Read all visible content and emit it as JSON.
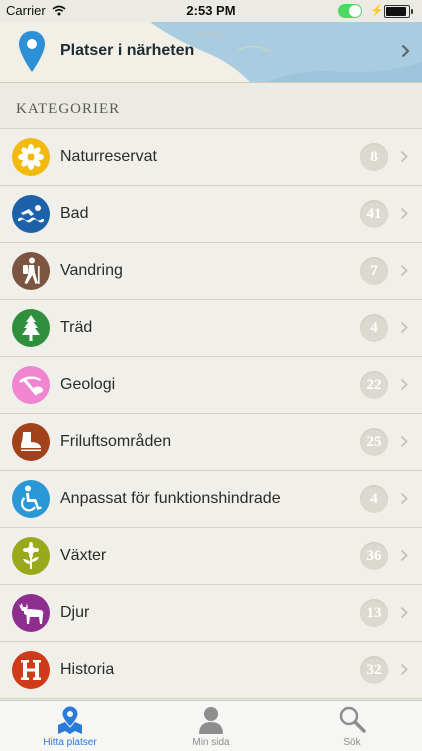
{
  "status_bar": {
    "carrier": "Carrier",
    "time": "2:53 PM"
  },
  "nearby": {
    "label": "Platser i närheten"
  },
  "section": {
    "title": "KATEGORIER"
  },
  "categories": [
    {
      "name": "Naturreservat",
      "count": "8",
      "icon": "flower-icon",
      "color": "#f2b90e"
    },
    {
      "name": "Bad",
      "count": "41",
      "icon": "swimmer-icon",
      "color": "#1d62a8"
    },
    {
      "name": "Vandring",
      "count": "7",
      "icon": "hiker-icon",
      "color": "#7b5542"
    },
    {
      "name": "Träd",
      "count": "4",
      "icon": "tree-icon",
      "color": "#2f8f3c"
    },
    {
      "name": "Geologi",
      "count": "22",
      "icon": "pickaxe-icon",
      "color": "#ef86cf"
    },
    {
      "name": "Friluftsområden",
      "count": "25",
      "icon": "boot-icon",
      "color": "#a2421c"
    },
    {
      "name": "Anpassat för funktionshindrade",
      "count": "4",
      "icon": "wheelchair-icon",
      "color": "#2a98d6"
    },
    {
      "name": "Växter",
      "count": "36",
      "icon": "plant-icon",
      "color": "#9aa81c"
    },
    {
      "name": "Djur",
      "count": "13",
      "icon": "moose-icon",
      "color": "#8e2e8e"
    },
    {
      "name": "Historia",
      "count": "32",
      "icon": "letter-h-icon",
      "color": "#cf3a18"
    }
  ],
  "tabs": [
    {
      "label": "Hitta platser",
      "icon": "map-pins-icon",
      "active": true
    },
    {
      "label": "Min sida",
      "icon": "person-icon",
      "active": false
    },
    {
      "label": "Sök",
      "icon": "search-icon",
      "active": false
    }
  ],
  "colors": {
    "accent": "#2a7ad8",
    "map_water": "#a9cce0",
    "pin": "#2d8fd6"
  }
}
